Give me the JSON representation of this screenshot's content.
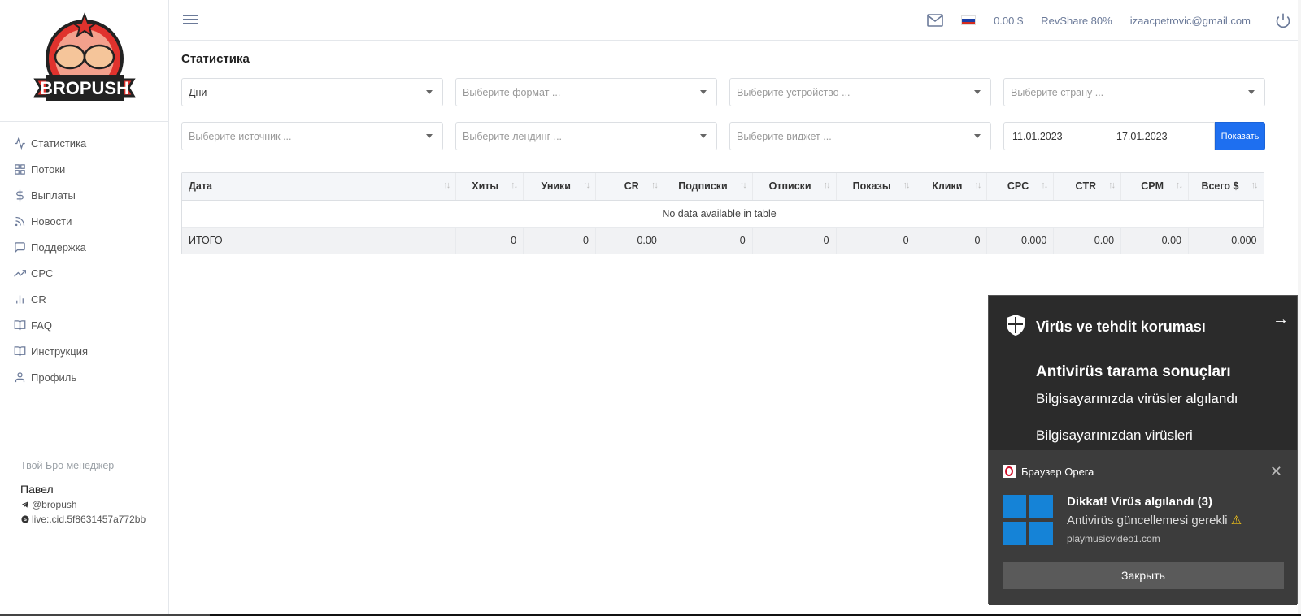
{
  "brand": {
    "logo_text": "BROPUSH"
  },
  "sidebar": {
    "items": [
      {
        "label": "Статистика",
        "icon": "activity-icon"
      },
      {
        "label": "Потоки",
        "icon": "grid-icon"
      },
      {
        "label": "Выплаты",
        "icon": "dollar-icon"
      },
      {
        "label": "Новости",
        "icon": "rss-icon"
      },
      {
        "label": "Поддержка",
        "icon": "message-icon"
      },
      {
        "label": "CPC",
        "icon": "trending-up-icon"
      },
      {
        "label": "CR",
        "icon": "bar-chart-icon"
      },
      {
        "label": "FAQ",
        "icon": "book-icon"
      },
      {
        "label": "Инструкция",
        "icon": "book-open-icon"
      },
      {
        "label": "Профиль",
        "icon": "user-icon"
      }
    ],
    "manager": {
      "title": "Твой Бро менеджер",
      "name": "Павел",
      "telegram": "@bropush",
      "skype": "live:.cid.5f8631457a772bb"
    }
  },
  "topbar": {
    "balance": "0.00 $",
    "revshare": "RevShare 80%",
    "email": "izaacpetrovic@gmail.com"
  },
  "page": {
    "title": "Статистика",
    "filters": {
      "period": "Дни",
      "format_placeholder": "Выберите формат ...",
      "device_placeholder": "Выберите устройство ...",
      "country_placeholder": "Выберите страну ...",
      "source_placeholder": "Выберите источник ...",
      "landing_placeholder": "Выберите лендинг ...",
      "widget_placeholder": "Выберите виджет ...",
      "date_from": "11.01.2023",
      "date_to": "17.01.2023",
      "show_button": "Показать"
    },
    "table": {
      "columns": [
        "Дата",
        "Хиты",
        "Уники",
        "CR",
        "Подписки",
        "Отписки",
        "Показы",
        "Клики",
        "CPC",
        "CTR",
        "CPM",
        "Всего $"
      ],
      "empty_message": "No data available in table",
      "total_row": [
        "ИТОГО",
        "0",
        "0",
        "0.00",
        "0",
        "0",
        "0",
        "0",
        "0.000",
        "0.00",
        "0.00",
        "0.000"
      ]
    }
  },
  "notification": {
    "security_title": "Virüs ve tehdit koruması",
    "scan_title": "Antivirüs tarama sonuçları",
    "line1": "Bilgisayarınızda virüsler algılandı",
    "line2": "Bilgisayarınızdan virüsleri",
    "app_name": "Браузер Opera",
    "headline": "Dikkat! Virüs algılandı (3)",
    "subline": "Antivirüs güncellemesi gerekli",
    "url": "playmusicvideo1.com",
    "close_button": "Закрыть"
  },
  "colors": {
    "accent": "#1e6ff0",
    "logo_red": "#e0322d"
  }
}
